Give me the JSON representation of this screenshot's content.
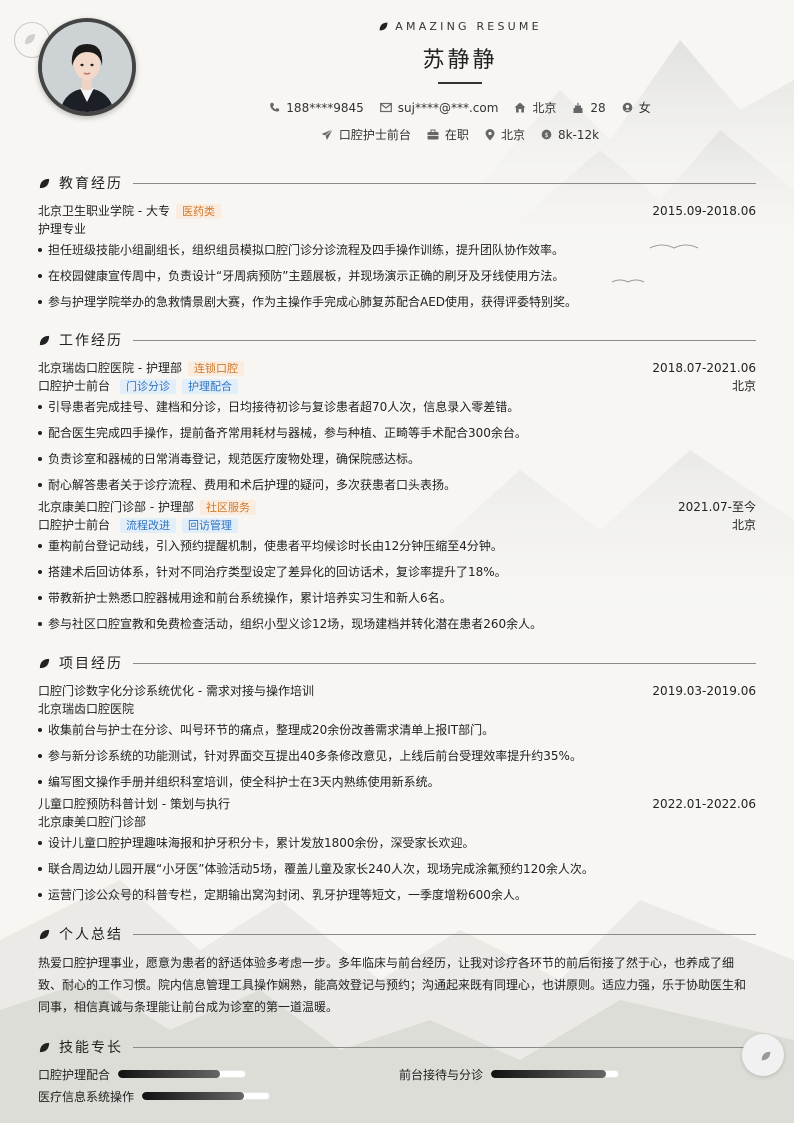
{
  "header": {
    "brand": "AMAZING RESUME",
    "name": "苏静静",
    "info_row1": [
      {
        "icon": "phone-icon",
        "text": "188****9845"
      },
      {
        "icon": "mail-icon",
        "text": "suj****@***.com"
      },
      {
        "icon": "home-icon",
        "text": "北京"
      },
      {
        "icon": "cake-icon",
        "text": "28"
      },
      {
        "icon": "gender-icon",
        "text": "女"
      }
    ],
    "info_row2": [
      {
        "icon": "send-icon",
        "text": "口腔护士前台"
      },
      {
        "icon": "briefcase-icon",
        "text": "在职"
      },
      {
        "icon": "location-icon",
        "text": "北京"
      },
      {
        "icon": "salary-icon",
        "text": "8k-12k"
      }
    ]
  },
  "education": {
    "title": "教育经历",
    "entries": [
      {
        "org": "北京卫生职业学院 - 大专",
        "tags": [
          "医药类"
        ],
        "date": "2015.09-2018.06",
        "sub": "护理专业",
        "bullets": [
          "担任班级技能小组副组长，组织组员模拟口腔门诊分诊流程及四手操作训练，提升团队协作效率。",
          "在校园健康宣传周中，负责设计“牙周病预防”主题展板，并现场演示正确的刷牙及牙线使用方法。",
          "参与护理学院举办的急救情景剧大赛，作为主操作手完成心肺复苏配合AED使用，获得评委特别奖。"
        ]
      }
    ]
  },
  "work": {
    "title": "工作经历",
    "entries": [
      {
        "org": "北京瑞齿口腔医院 - 护理部",
        "tag": "连锁口腔",
        "date": "2018.07-2021.06",
        "role": "口腔护士前台",
        "role_tags": [
          "门诊分诊",
          "护理配合"
        ],
        "city": "北京",
        "bullets": [
          "引导患者完成挂号、建档和分诊，日均接待初诊与复诊患者超70人次，信息录入零差错。",
          "配合医生完成四手操作，提前备齐常用耗材与器械，参与种植、正畸等手术配合300余台。",
          "负责诊室和器械的日常消毒登记，规范医疗废物处理，确保院感达标。",
          "耐心解答患者关于诊疗流程、费用和术后护理的疑问，多次获患者口头表扬。"
        ]
      },
      {
        "org": "北京康美口腔门诊部 - 护理部",
        "tag": "社区服务",
        "date": "2021.07-至今",
        "role": "口腔护士前台",
        "role_tags": [
          "流程改进",
          "回访管理"
        ],
        "city": "北京",
        "bullets": [
          "重构前台登记动线，引入预约提醒机制，使患者平均候诊时长由12分钟压缩至4分钟。",
          "搭建术后回访体系，针对不同治疗类型设定了差异化的回访话术，复诊率提升了18%。",
          "带教新护士熟悉口腔器械用途和前台系统操作，累计培养实习生和新人6名。",
          "参与社区口腔宣教和免费检查活动，组织小型义诊12场，现场建档并转化潜在患者260余人。"
        ]
      }
    ]
  },
  "projects": {
    "title": "项目经历",
    "entries": [
      {
        "name": "口腔门诊数字化分诊系统优化 - 需求对接与操作培训",
        "date": "2019.03-2019.06",
        "org": "北京瑞齿口腔医院",
        "bullets": [
          "收集前台与护士在分诊、叫号环节的痛点，整理成20余份改善需求清单上报IT部门。",
          "参与新分诊系统的功能测试，针对界面交互提出40多条修改意见，上线后前台受理效率提升约35%。",
          "编写图文操作手册并组织科室培训，使全科护士在3天内熟练使用新系统。"
        ]
      },
      {
        "name": "儿童口腔预防科普计划 - 策划与执行",
        "date": "2022.01-2022.06",
        "org": "北京康美口腔门诊部",
        "bullets": [
          "设计儿童口腔护理趣味海报和护牙积分卡，累计发放1800余份，深受家长欢迎。",
          "联合周边幼儿园开展“小牙医”体验活动5场，覆盖儿童及家长240人次，现场完成涂氟预约120余人次。",
          "运营门诊公众号的科普专栏，定期输出窝沟封闭、乳牙护理等短文，一季度增粉600余人。"
        ]
      }
    ]
  },
  "summary": {
    "title": "个人总结",
    "lines": [
      "热爱口腔护理事业，愿意为患者的舒适体验多考虑一步。多年临床与前台经历，让我对诊疗各环节的前后衔接了然于心，也养成了细",
      "致、耐心的工作习惯。院内信息管理工具操作娴熟，能高效登记与预约；沟通起来既有同理心，也讲原则。适应力强，乐于协助医生和",
      "同事，相信真诚与条理能让前台成为诊室的第一道温暖。"
    ]
  },
  "skills": {
    "title": "技能专长",
    "items": [
      {
        "name": "口腔护理配合",
        "level": 0.8
      },
      {
        "name": "前台接待与分诊",
        "level": 0.9
      },
      {
        "name": "医疗信息系统操作",
        "level": 0.8
      }
    ]
  },
  "colors": {
    "tag_orange_bg": "#fbece0",
    "tag_orange_text": "#d07a2c",
    "tag_blue_bg": "#e2eefa",
    "tag_blue_text": "#2f74c0",
    "bar_fill": "#222222"
  }
}
